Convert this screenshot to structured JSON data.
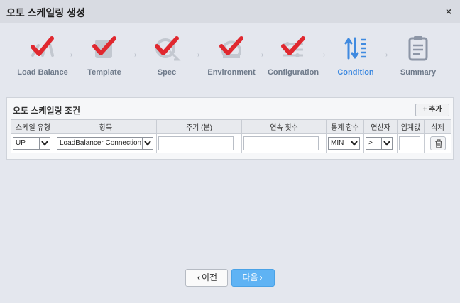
{
  "window": {
    "title": "오토 스케일링 생성",
    "close_icon": "×"
  },
  "wizard": {
    "steps": [
      {
        "label": "Load Balance",
        "icon": "load-balance-icon",
        "done": true
      },
      {
        "label": "Template",
        "icon": "template-icon",
        "done": true
      },
      {
        "label": "Spec",
        "icon": "spec-icon",
        "done": true
      },
      {
        "label": "Environment",
        "icon": "environment-icon",
        "done": true
      },
      {
        "label": "Configuration",
        "icon": "configuration-icon",
        "done": true
      },
      {
        "label": "Condition",
        "icon": "condition-icon",
        "active": true
      },
      {
        "label": "Summary",
        "icon": "summary-icon"
      }
    ],
    "arrow": "›"
  },
  "panel": {
    "title": "오토 스케일링 조건",
    "add_button": "+ 추가",
    "columns": [
      "스케일 유형",
      "항목",
      "주기 (분)",
      "연속 횟수",
      "통계 함수",
      "연산자",
      "임계값",
      "삭제"
    ],
    "row": {
      "scale_type": "UP",
      "item": "LoadBalancer Connection",
      "period": "",
      "consecutive": "",
      "stat_function": "MIN",
      "operator": ">",
      "threshold": ""
    }
  },
  "footer": {
    "prev_label": "이전",
    "next_label": "다음",
    "prev_icon": "‹",
    "next_icon": "›"
  },
  "colors": {
    "check": "#e0282f",
    "active": "#3f8ae0",
    "next_button": "#5fb3f4"
  }
}
